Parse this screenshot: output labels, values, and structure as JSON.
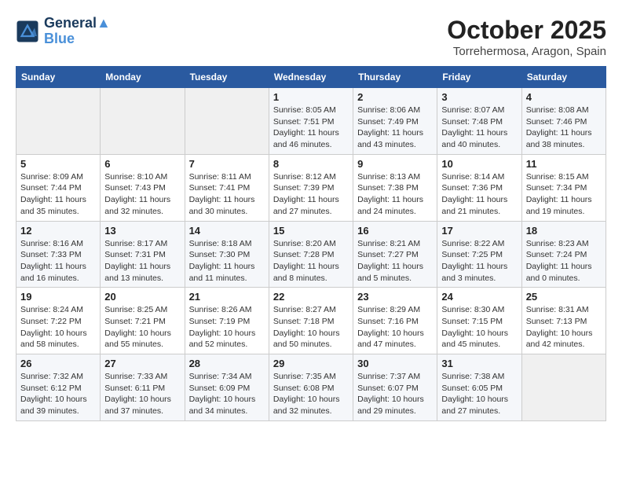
{
  "logo": {
    "line1": "General",
    "line2": "Blue"
  },
  "title": "October 2025",
  "subtitle": "Torrehermosa, Aragon, Spain",
  "weekdays": [
    "Sunday",
    "Monday",
    "Tuesday",
    "Wednesday",
    "Thursday",
    "Friday",
    "Saturday"
  ],
  "weeks": [
    [
      {
        "day": "",
        "info": ""
      },
      {
        "day": "",
        "info": ""
      },
      {
        "day": "",
        "info": ""
      },
      {
        "day": "1",
        "info": "Sunrise: 8:05 AM\nSunset: 7:51 PM\nDaylight: 11 hours and 46 minutes."
      },
      {
        "day": "2",
        "info": "Sunrise: 8:06 AM\nSunset: 7:49 PM\nDaylight: 11 hours and 43 minutes."
      },
      {
        "day": "3",
        "info": "Sunrise: 8:07 AM\nSunset: 7:48 PM\nDaylight: 11 hours and 40 minutes."
      },
      {
        "day": "4",
        "info": "Sunrise: 8:08 AM\nSunset: 7:46 PM\nDaylight: 11 hours and 38 minutes."
      }
    ],
    [
      {
        "day": "5",
        "info": "Sunrise: 8:09 AM\nSunset: 7:44 PM\nDaylight: 11 hours and 35 minutes."
      },
      {
        "day": "6",
        "info": "Sunrise: 8:10 AM\nSunset: 7:43 PM\nDaylight: 11 hours and 32 minutes."
      },
      {
        "day": "7",
        "info": "Sunrise: 8:11 AM\nSunset: 7:41 PM\nDaylight: 11 hours and 30 minutes."
      },
      {
        "day": "8",
        "info": "Sunrise: 8:12 AM\nSunset: 7:39 PM\nDaylight: 11 hours and 27 minutes."
      },
      {
        "day": "9",
        "info": "Sunrise: 8:13 AM\nSunset: 7:38 PM\nDaylight: 11 hours and 24 minutes."
      },
      {
        "day": "10",
        "info": "Sunrise: 8:14 AM\nSunset: 7:36 PM\nDaylight: 11 hours and 21 minutes."
      },
      {
        "day": "11",
        "info": "Sunrise: 8:15 AM\nSunset: 7:34 PM\nDaylight: 11 hours and 19 minutes."
      }
    ],
    [
      {
        "day": "12",
        "info": "Sunrise: 8:16 AM\nSunset: 7:33 PM\nDaylight: 11 hours and 16 minutes."
      },
      {
        "day": "13",
        "info": "Sunrise: 8:17 AM\nSunset: 7:31 PM\nDaylight: 11 hours and 13 minutes."
      },
      {
        "day": "14",
        "info": "Sunrise: 8:18 AM\nSunset: 7:30 PM\nDaylight: 11 hours and 11 minutes."
      },
      {
        "day": "15",
        "info": "Sunrise: 8:20 AM\nSunset: 7:28 PM\nDaylight: 11 hours and 8 minutes."
      },
      {
        "day": "16",
        "info": "Sunrise: 8:21 AM\nSunset: 7:27 PM\nDaylight: 11 hours and 5 minutes."
      },
      {
        "day": "17",
        "info": "Sunrise: 8:22 AM\nSunset: 7:25 PM\nDaylight: 11 hours and 3 minutes."
      },
      {
        "day": "18",
        "info": "Sunrise: 8:23 AM\nSunset: 7:24 PM\nDaylight: 11 hours and 0 minutes."
      }
    ],
    [
      {
        "day": "19",
        "info": "Sunrise: 8:24 AM\nSunset: 7:22 PM\nDaylight: 10 hours and 58 minutes."
      },
      {
        "day": "20",
        "info": "Sunrise: 8:25 AM\nSunset: 7:21 PM\nDaylight: 10 hours and 55 minutes."
      },
      {
        "day": "21",
        "info": "Sunrise: 8:26 AM\nSunset: 7:19 PM\nDaylight: 10 hours and 52 minutes."
      },
      {
        "day": "22",
        "info": "Sunrise: 8:27 AM\nSunset: 7:18 PM\nDaylight: 10 hours and 50 minutes."
      },
      {
        "day": "23",
        "info": "Sunrise: 8:29 AM\nSunset: 7:16 PM\nDaylight: 10 hours and 47 minutes."
      },
      {
        "day": "24",
        "info": "Sunrise: 8:30 AM\nSunset: 7:15 PM\nDaylight: 10 hours and 45 minutes."
      },
      {
        "day": "25",
        "info": "Sunrise: 8:31 AM\nSunset: 7:13 PM\nDaylight: 10 hours and 42 minutes."
      }
    ],
    [
      {
        "day": "26",
        "info": "Sunrise: 7:32 AM\nSunset: 6:12 PM\nDaylight: 10 hours and 39 minutes."
      },
      {
        "day": "27",
        "info": "Sunrise: 7:33 AM\nSunset: 6:11 PM\nDaylight: 10 hours and 37 minutes."
      },
      {
        "day": "28",
        "info": "Sunrise: 7:34 AM\nSunset: 6:09 PM\nDaylight: 10 hours and 34 minutes."
      },
      {
        "day": "29",
        "info": "Sunrise: 7:35 AM\nSunset: 6:08 PM\nDaylight: 10 hours and 32 minutes."
      },
      {
        "day": "30",
        "info": "Sunrise: 7:37 AM\nSunset: 6:07 PM\nDaylight: 10 hours and 29 minutes."
      },
      {
        "day": "31",
        "info": "Sunrise: 7:38 AM\nSunset: 6:05 PM\nDaylight: 10 hours and 27 minutes."
      },
      {
        "day": "",
        "info": ""
      }
    ]
  ]
}
